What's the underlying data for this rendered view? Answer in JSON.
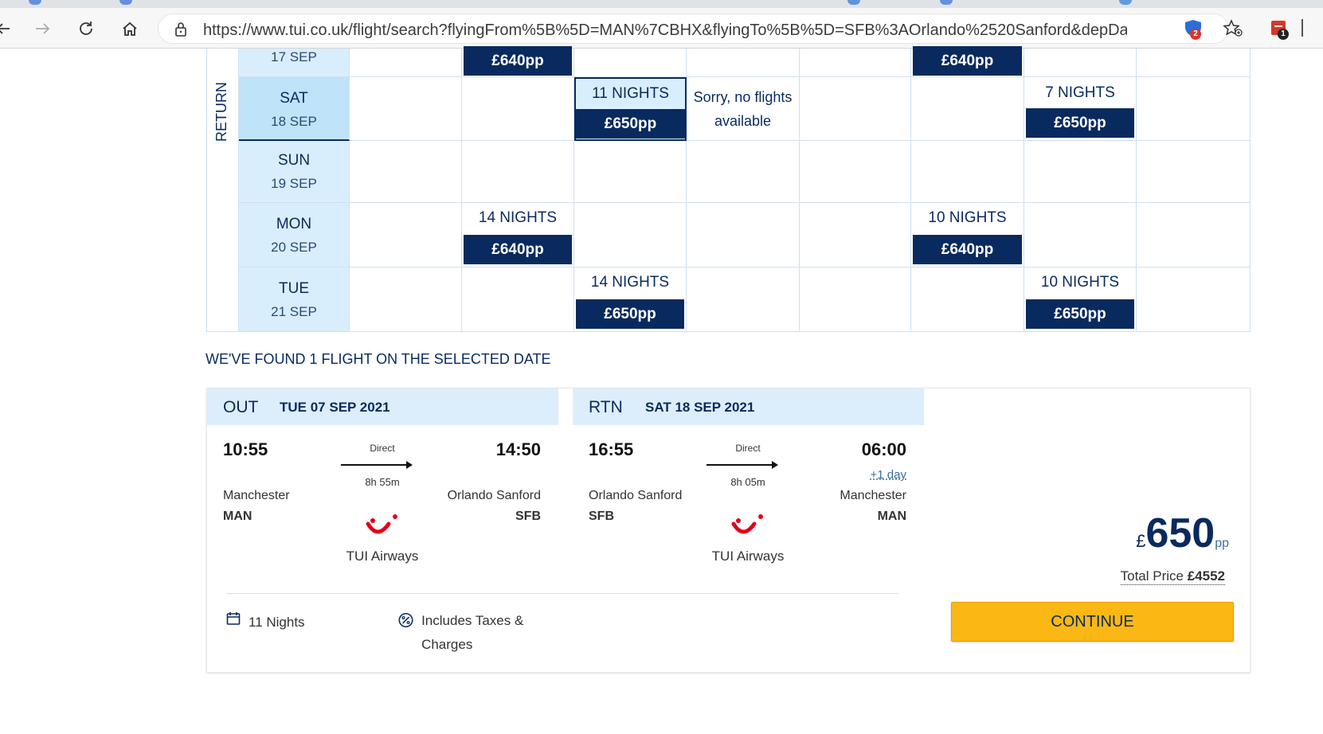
{
  "browser": {
    "url": "https://www.tui.co.uk/flight/search?flyingFrom%5B%5D=MAN%7CBHX&flyingTo%5B%5D=SFB%3AOrlando%2520Sanford&depDate=...",
    "extension_badge_1": "2",
    "extension_badge_2": "1"
  },
  "calendar": {
    "return_label": "RETURN",
    "rows": [
      {
        "dow": "",
        "date": "17 SEP"
      },
      {
        "dow": "SAT",
        "date": "18 SEP"
      },
      {
        "dow": "SUN",
        "date": "19 SEP"
      },
      {
        "dow": "MON",
        "date": "20 SEP"
      },
      {
        "dow": "TUE",
        "date": "21 SEP"
      }
    ],
    "cells": {
      "r0_c2_price": "£640pp",
      "r0_c6_price": "£640pp",
      "r1_c3_nights": "11 NIGHTS",
      "r1_c3_price": "£650pp",
      "r1_c4_sorry_line1": "Sorry, no flights",
      "r1_c4_sorry_line2": "available",
      "r1_c7_nights": "7 NIGHTS",
      "r1_c7_price": "£650pp",
      "r3_c2_nights": "14 NIGHTS",
      "r3_c2_price": "£640pp",
      "r3_c6_nights": "10 NIGHTS",
      "r3_c6_price": "£640pp",
      "r4_c3_nights": "14 NIGHTS",
      "r4_c3_price": "£650pp",
      "r4_c7_nights": "10 NIGHTS",
      "r4_c7_price": "£650pp"
    }
  },
  "results": {
    "heading": "WE'VE FOUND 1 FLIGHT ON THE SELECTED DATE"
  },
  "flight": {
    "out": {
      "dir": "OUT",
      "date": "TUE 07 SEP 2021",
      "dep_time": "10:55",
      "arr_time": "14:50",
      "stops": "Direct",
      "duration": "8h 55m",
      "from_city": "Manchester",
      "from_code": "MAN",
      "to_city": "Orlando Sanford",
      "to_code": "SFB",
      "airline": "TUI Airways"
    },
    "rtn": {
      "dir": "RTN",
      "date": "SAT 18 SEP 2021",
      "dep_time": "16:55",
      "arr_time": "06:00",
      "next_day": "+1 day",
      "stops": "Direct",
      "duration": "8h 05m",
      "from_city": "Orlando Sanford",
      "from_code": "SFB",
      "to_city": "Manchester",
      "to_code": "MAN",
      "airline": "TUI Airways"
    },
    "nights": "11 Nights",
    "taxes": "Includes Taxes & Charges",
    "price_currency": "£",
    "price_amount": "650",
    "price_unit": "pp",
    "total_label": "Total Price",
    "total_value": "£4552",
    "continue_label": "CONTINUE"
  },
  "colors": {
    "brand_navy": "#092a5e",
    "light_blue": "#d8eefc",
    "cta_yellow": "#fbb814",
    "tui_red": "#e2001a"
  }
}
